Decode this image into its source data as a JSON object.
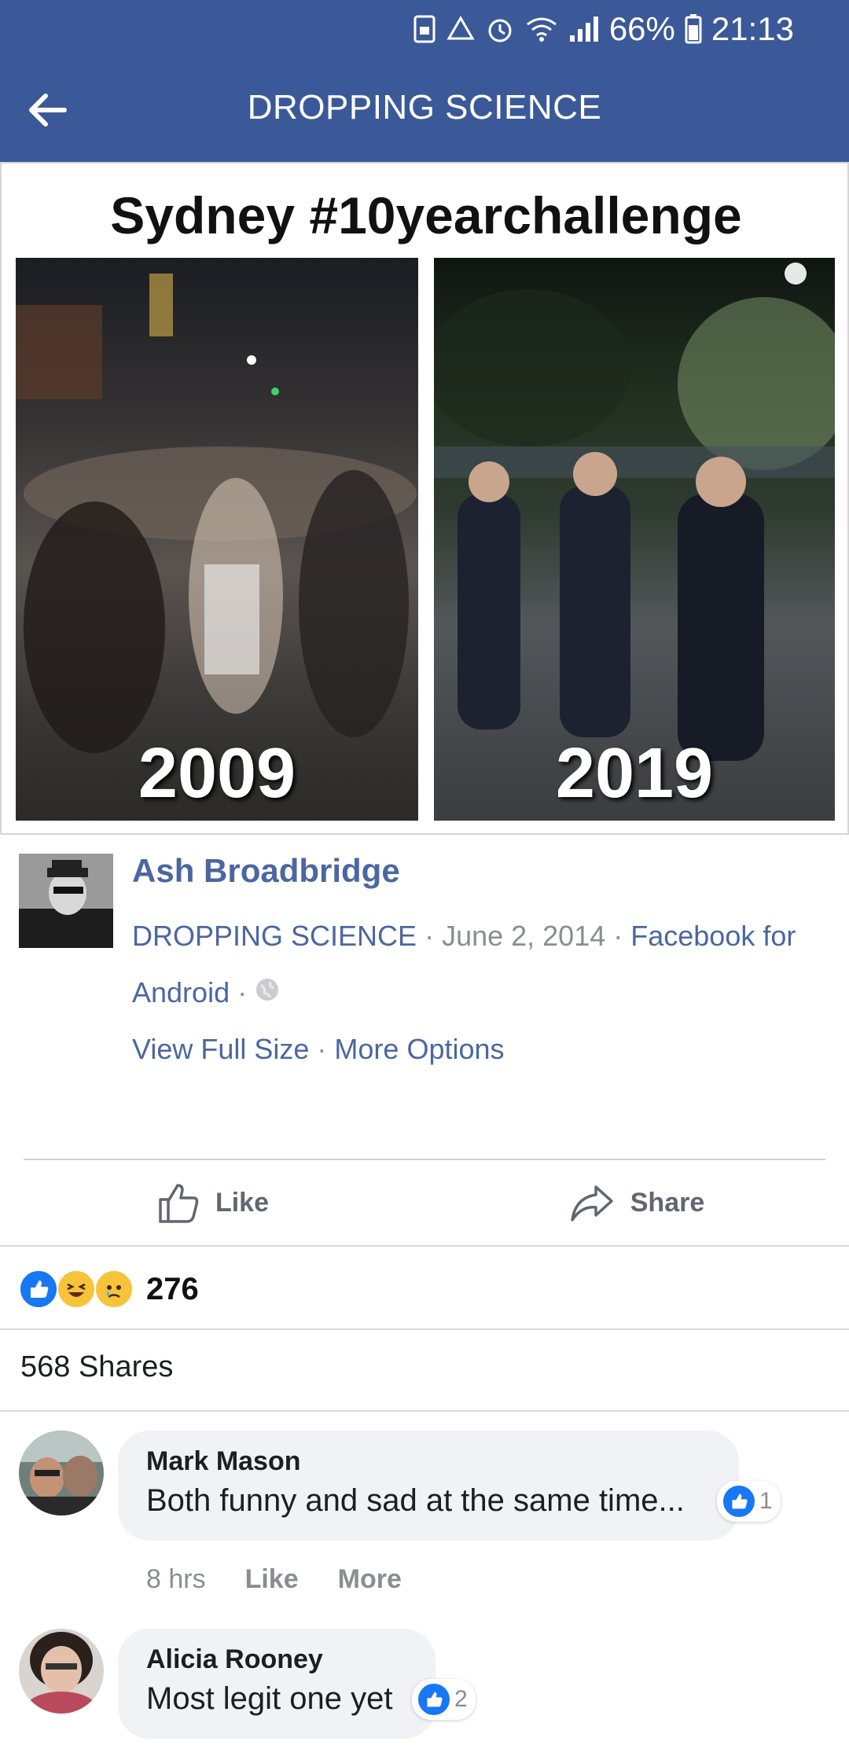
{
  "status_bar": {
    "icons": [
      "save-icon",
      "recycle-icon",
      "alarm-icon",
      "wifi-icon",
      "signal-icon"
    ],
    "battery": "66%",
    "time": "21:13"
  },
  "app_bar": {
    "back_icon": "arrow-left-icon",
    "title": "DROPPING SCIENCE"
  },
  "photo": {
    "caption_title": "Sydney #10yearchallenge",
    "left_label": "2009",
    "right_label": "2019"
  },
  "post": {
    "author": "Ash Broadbridge",
    "page": "DROPPING SCIENCE",
    "separator": " · ",
    "date": "June 2, 2014",
    "app_part1": "Facebook for",
    "app_part2": "Android",
    "privacy_icon": "globe-icon",
    "view_full_size": "View Full Size",
    "more_options": "More Options"
  },
  "actions": {
    "like_label": "Like",
    "share_label": "Share"
  },
  "reactions": {
    "types": [
      "like-reaction-icon",
      "laugh-reaction-icon",
      "sad-reaction-icon"
    ],
    "count": "276"
  },
  "shares": "568 Shares",
  "comments": [
    {
      "name": "Mark Mason",
      "text": "Both funny and sad at the same time...",
      "likes": "1",
      "time": "8 hrs",
      "like_label": "Like",
      "more_label": "More"
    },
    {
      "name": "Alicia Rooney",
      "text": "Most legit one yet",
      "likes": "2"
    }
  ],
  "colors": {
    "header": "#3b5998",
    "link": "#4b67a1",
    "muted": "#8a8d91",
    "like_blue": "#1877f2"
  }
}
